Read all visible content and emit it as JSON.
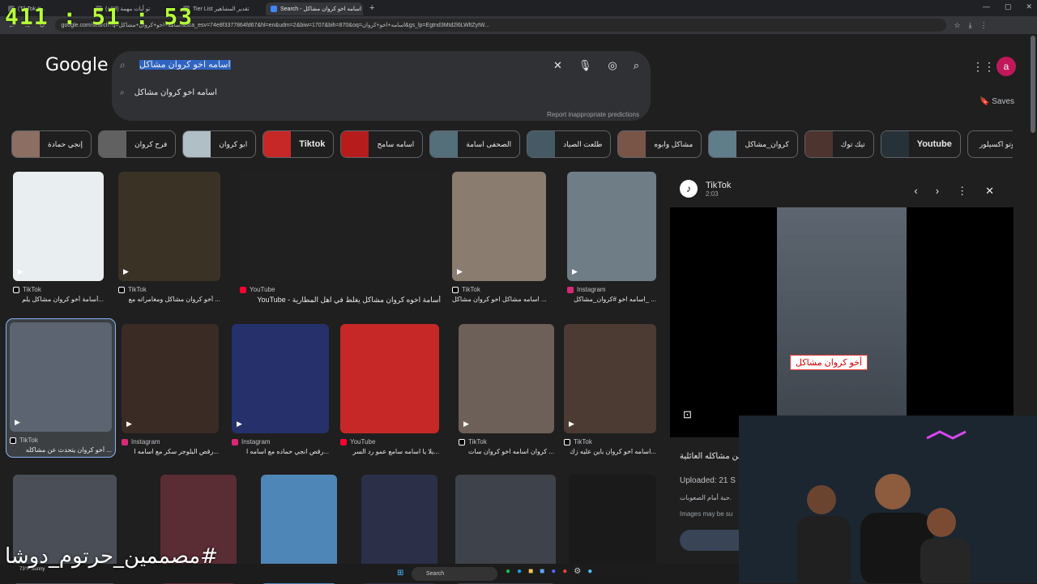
{
  "overlay": {
    "clock": "411 : 51 : 53",
    "watermark": "#مصممين_حرتوم_دوشا"
  },
  "tabs": [
    {
      "label": "(TikTok #..."
    },
    {
      "label": "تو أيات مهمة (99+)"
    },
    {
      "label": "Tier List تقدير المشاهير"
    },
    {
      "label": "Search - اسامه اخو كروان مشاكل",
      "active": true
    }
  ],
  "address": {
    "url": "google.com/search?q=اسامه+اخو+كروان+مشاكل&sca_esv=74e8f3377864fd67&hl=en&udm=2&biw=1707&bih=870&oq=اسامه+اخو+كروان&gs_lp=Egtnd3Mtd2l6LWltZyIW..."
  },
  "header": {
    "logo": "Google",
    "avatar_letter": "a",
    "saves_label": "Saves"
  },
  "search": {
    "query": "اسامه اخو كروان مشاكل",
    "suggestion": "اسامه اخو كروان مشاكل",
    "report": "Report inappropriate predictions"
  },
  "chips": [
    {
      "label": "إنجي حمادة"
    },
    {
      "label": "فرح كروان"
    },
    {
      "label": "ابو كروان"
    },
    {
      "label": "Tiktok"
    },
    {
      "label": "اسامه سامح"
    },
    {
      "label": "الصحفى اسامة"
    },
    {
      "label": "طلعت الصياد"
    },
    {
      "label": "مشاكل وابوه"
    },
    {
      "label": "كروان_مشاكل"
    },
    {
      "label": "تيك توك"
    },
    {
      "label": "Youtube"
    },
    {
      "label": "دوتو اكسيلور"
    }
  ],
  "results_row1": [
    {
      "source": "TikTok",
      "title": "أسامة أخو كروان مشاكل يلم...",
      "color": "#e9eef0"
    },
    {
      "source": "TikTok",
      "title": "أخو كروان مشاكل ومغامراته مع ...",
      "color": "#3b3226"
    },
    {
      "source": "YouTube",
      "title": "YouTube - أسامة اخوه كروان مشاكل يغلط في اهل المطارية",
      "color": "#202020"
    },
    {
      "source": "TikTok",
      "title": "اسامه مشاكل اخو كروان مشاكل ...",
      "color": "#8a7d70"
    },
    {
      "source": "Instagram",
      "title": "اسامه اخو #كروان_مشاكل_ ...",
      "color": "#6f7d87"
    }
  ],
  "results_row2": [
    {
      "source": "TikTok",
      "title": "أخو كروان يتحدث عن مشاكله ...",
      "color": "#5b6470"
    },
    {
      "source": "Instagram",
      "title": "رقص البلوجر سكر مع اسامه ا...",
      "color": "#3a2b25"
    },
    {
      "source": "Instagram",
      "title": "رقص انجي حماده مع اسامه ا...",
      "color": "#26306b"
    },
    {
      "source": "YouTube",
      "title": "يلا يا اسامه سامع عمو رد السر...",
      "color": "#c62828"
    },
    {
      "source": "TikTok",
      "title": "كروان اسامه اخو كروان سات ...",
      "color": "#6d6058"
    },
    {
      "source": "TikTok",
      "title": "اسامه اخو كروان باين عليه زك...",
      "color": "#4b3b33"
    }
  ],
  "results_row3": [
    {
      "color": "#4a4f57"
    },
    {
      "color": "#5a2c33"
    },
    {
      "color": "#4f86b8"
    },
    {
      "color": "#2c2f48"
    },
    {
      "color": "#3e434b"
    },
    {
      "color": "#1a1a1a"
    }
  ],
  "panel": {
    "source": "TikTok",
    "duration": "2:03",
    "video_caption": "أخو كروان مشاكل",
    "title": "من مشاكله العائلية",
    "uploaded": "Uploaded: 21 S",
    "desc": "حبة أمام الصعوبات.",
    "note": "Images may be su"
  },
  "taskbar": {
    "weather": "73°F Sunny",
    "search": "Search"
  }
}
